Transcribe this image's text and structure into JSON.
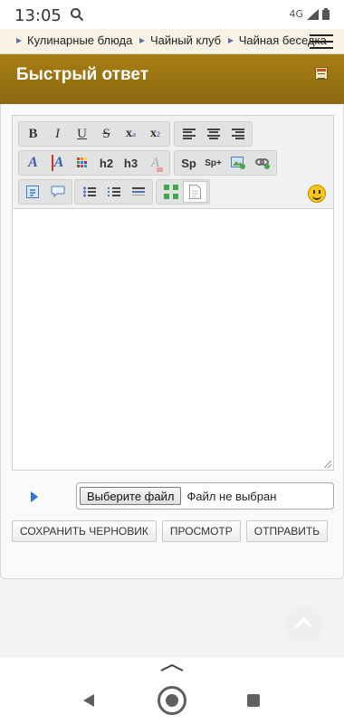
{
  "status_bar": {
    "time": "13:05",
    "network": "4G",
    "icons": [
      "search-icon",
      "signal-icon",
      "battery-icon"
    ]
  },
  "breadcrumb": {
    "items": [
      "Кулинарные блюда",
      "Чайный клуб",
      "Чайная беседка"
    ]
  },
  "header": {
    "title": "Быстрый ответ",
    "accent_color": "#9a7413"
  },
  "toolbar": {
    "row1": {
      "format_buttons": [
        {
          "label": "B",
          "icon": "bold-icon"
        },
        {
          "label": "I",
          "icon": "italic-icon"
        },
        {
          "label": "U",
          "icon": "underline-icon"
        },
        {
          "label": "S",
          "icon": "strikethrough-icon"
        },
        {
          "label": "x",
          "icon": "superscript-icon"
        },
        {
          "label": "x",
          "icon": "subscript-icon"
        }
      ],
      "align_buttons": [
        "align-left-icon",
        "align-center-icon",
        "align-right-icon"
      ]
    },
    "row2": {
      "style_buttons": [
        "font-icon",
        "font-color-icon",
        "color-palette-icon"
      ],
      "h2_label": "h2",
      "h3_label": "h3",
      "clear_format_icon": "clear-format-icon",
      "sp_label": "Sp",
      "sp_plus_label": "Sp+",
      "insert_buttons": [
        "insert-image-icon",
        "insert-link-icon"
      ]
    },
    "row3": {
      "misc_buttons": [
        "quote-icon",
        "spoiler-icon"
      ],
      "list_buttons": [
        "bullet-list-icon",
        "numbered-list-icon",
        "horizontal-rule-icon"
      ],
      "view_buttons": [
        "fullscreen-icon",
        "source-view-icon"
      ],
      "emoticon_icon": "smiley-icon"
    }
  },
  "attachment": {
    "choose_file_label": "Выберите файл",
    "no_file_label": "Файл не выбран"
  },
  "actions": {
    "save_draft": "СОХРАНИТЬ ЧЕРНОВИК",
    "preview": "ПРОСМОТР",
    "submit": "ОТПРАВИТЬ"
  },
  "nav_bar": {
    "buttons": [
      "back-icon",
      "home-icon",
      "recent-apps-icon"
    ]
  }
}
